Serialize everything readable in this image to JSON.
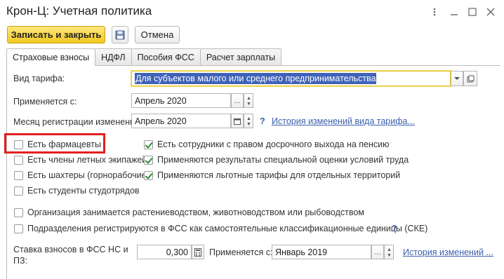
{
  "window": {
    "title": "Крон-Ц: Учетная политика"
  },
  "toolbar": {
    "save_close": "Записать и закрыть",
    "cancel": "Отмена"
  },
  "tabs": [
    "Страховые взносы",
    "НДФЛ",
    "Пособия ФСС",
    "Расчет зарплаты"
  ],
  "form": {
    "tariff_label": "Вид тарифа:",
    "tariff_value": "Для субъектов малого или среднего предпринимательства",
    "applies_label": "Применяется с:",
    "applies_value": "Апрель 2020",
    "reg_month_label": "Месяц регистрации изменений:",
    "reg_month_value": "Апрель 2020",
    "history_link": "История изменений вида тарифа...",
    "help_mark": "?",
    "ellipsis": "...",
    "rate_label": "Ставка взносов в ФСС НС и ПЗ:",
    "rate_value": "0,300",
    "rate_applies_label": "Применяется с:",
    "rate_applies_value": "Январь 2019",
    "rate_history_link": "История изменений ..."
  },
  "checkboxes_left": [
    {
      "label": "Есть фармацевты",
      "checked": false
    },
    {
      "label": "Есть члены летных экипажей",
      "checked": false
    },
    {
      "label": "Есть шахтеры (горнорабочие)",
      "checked": false
    },
    {
      "label": "Есть студенты студотрядов",
      "checked": false
    }
  ],
  "checkboxes_right": [
    {
      "label": "Есть сотрудники с правом досрочного выхода на пенсию",
      "checked": true
    },
    {
      "label": "Применяются результаты специальной оценки условий труда",
      "checked": true
    },
    {
      "label": "Применяются льготные тарифы для отдельных территорий",
      "checked": true
    }
  ],
  "checkboxes_bottom": [
    {
      "label": "Организация занимается растениеводством, животноводством или рыбоводством",
      "checked": false
    },
    {
      "label": "Подразделения регистрируются в ФСС как самостоятельные классификационные единицы (СКЕ)",
      "checked": false
    }
  ],
  "colors": {
    "accent_button": "#f4c91f",
    "link": "#3a5fae",
    "highlight_frame": "#e02020",
    "selection": "#3f62b8"
  }
}
